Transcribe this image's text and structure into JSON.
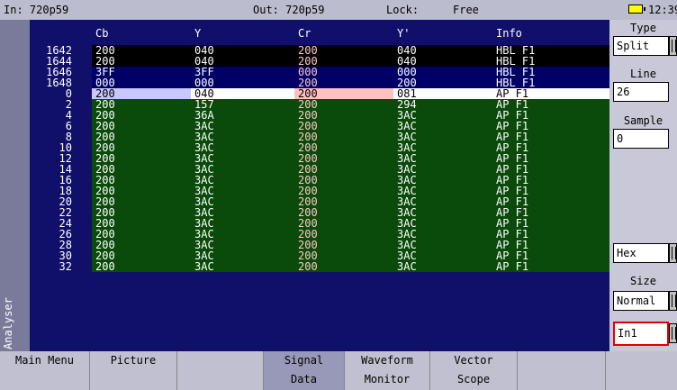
{
  "status": {
    "input": "In: 720p59",
    "output": "Out: 720p59",
    "lock_label": "Lock:",
    "lock_value": "Free",
    "time": "12:39"
  },
  "sidebar": {
    "label": "Analyser"
  },
  "table": {
    "headers": [
      "Cb",
      "Y",
      "Cr",
      "Y'",
      "Info"
    ],
    "line_numbers": [
      "1642",
      "1644",
      "1646",
      "1648",
      "0",
      "2",
      "4",
      "6",
      "8",
      "10",
      "12",
      "14",
      "16",
      "18",
      "20",
      "22",
      "24",
      "26",
      "28",
      "30",
      "32"
    ],
    "rows": [
      [
        "200",
        "040",
        "200",
        "040",
        "HBL F1"
      ],
      [
        "200",
        "040",
        "200",
        "040",
        "HBL F1"
      ],
      [
        "3FF",
        "3FF",
        "000",
        "000",
        "HBL F1"
      ],
      [
        "000",
        "000",
        "200",
        "200",
        "HBL F1"
      ],
      [
        "200",
        "040",
        "200",
        "081",
        "AP F1"
      ],
      [
        "200",
        "157",
        "200",
        "294",
        "AP F1"
      ],
      [
        "200",
        "36A",
        "200",
        "3AC",
        "AP F1"
      ],
      [
        "200",
        "3AC",
        "200",
        "3AC",
        "AP F1"
      ],
      [
        "200",
        "3AC",
        "200",
        "3AC",
        "AP F1"
      ],
      [
        "200",
        "3AC",
        "200",
        "3AC",
        "AP F1"
      ],
      [
        "200",
        "3AC",
        "200",
        "3AC",
        "AP F1"
      ],
      [
        "200",
        "3AC",
        "200",
        "3AC",
        "AP F1"
      ],
      [
        "200",
        "3AC",
        "200",
        "3AC",
        "AP F1"
      ],
      [
        "200",
        "3AC",
        "200",
        "3AC",
        "AP F1"
      ],
      [
        "200",
        "3AC",
        "200",
        "3AC",
        "AP F1"
      ],
      [
        "200",
        "3AC",
        "200",
        "3AC",
        "AP F1"
      ],
      [
        "200",
        "3AC",
        "200",
        "3AC",
        "AP F1"
      ],
      [
        "200",
        "3AC",
        "200",
        "3AC",
        "AP F1"
      ],
      [
        "200",
        "3AC",
        "200",
        "3AC",
        "AP F1"
      ],
      [
        "200",
        "3AC",
        "200",
        "3AC",
        "AP F1"
      ],
      [
        "200",
        "3AC",
        "200",
        "3AC",
        "AP F1"
      ]
    ]
  },
  "controls": {
    "type_label": "Type",
    "type_value": "Split",
    "line_label": "Line",
    "line_value": "26",
    "sample_label": "Sample",
    "sample_value": "0",
    "format_value": "Hex",
    "size_label": "Size",
    "size_value": "Normal",
    "input_value": "In1"
  },
  "softkeys": [
    {
      "line1": "Main Menu",
      "line2": ""
    },
    {
      "line1": "Picture",
      "line2": ""
    },
    {
      "line1": "",
      "line2": ""
    },
    {
      "line1": "Signal",
      "line2": "Data"
    },
    {
      "line1": "Waveform",
      "line2": "Monitor"
    },
    {
      "line1": "Vector",
      "line2": "Scope"
    },
    {
      "line1": "",
      "line2": ""
    },
    {
      "line1": "",
      "line2": ""
    }
  ],
  "colors": {
    "row_hbl_black": "#000000",
    "row_hbl_blue": "#000066",
    "row_active_green": "#0a4a0a",
    "selected_row": "#ffffff",
    "cb_highlight": "#c8c8ff",
    "cr_highlight": "#ffc0c0",
    "chroma_text": "#ffc8c8",
    "input_field_border": "#e00000"
  }
}
